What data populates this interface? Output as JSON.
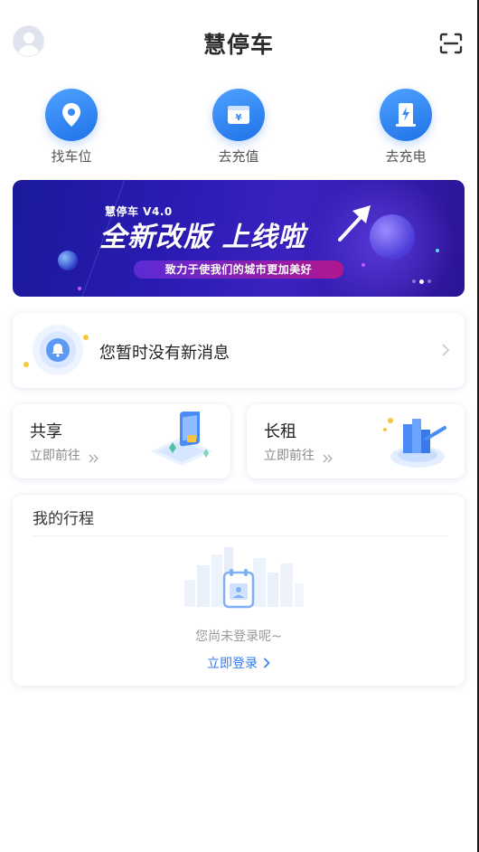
{
  "header": {
    "app_title": "慧停车"
  },
  "quick_actions": [
    {
      "label": "找车位",
      "icon": "location-pin-icon"
    },
    {
      "label": "去充值",
      "icon": "wallet-icon"
    },
    {
      "label": "去充电",
      "icon": "charging-station-icon"
    }
  ],
  "banner": {
    "version": "慧停车 V4.0",
    "headline": "全新改版 上线啦",
    "tagline": "致力于使我们的城市更加美好"
  },
  "message": {
    "text": "您暂时没有新消息"
  },
  "cards": {
    "share": {
      "title": "共享",
      "action": "立即前往"
    },
    "lease": {
      "title": "长租",
      "action": "立即前往"
    }
  },
  "trip": {
    "title": "我的行程",
    "empty_text": "您尚未登录呢~",
    "login_label": "立即登录"
  },
  "colors": {
    "accent": "#2f7cf0",
    "banner_bg": "#2a1bb3",
    "text_primary": "#222222",
    "text_secondary": "#888888"
  }
}
